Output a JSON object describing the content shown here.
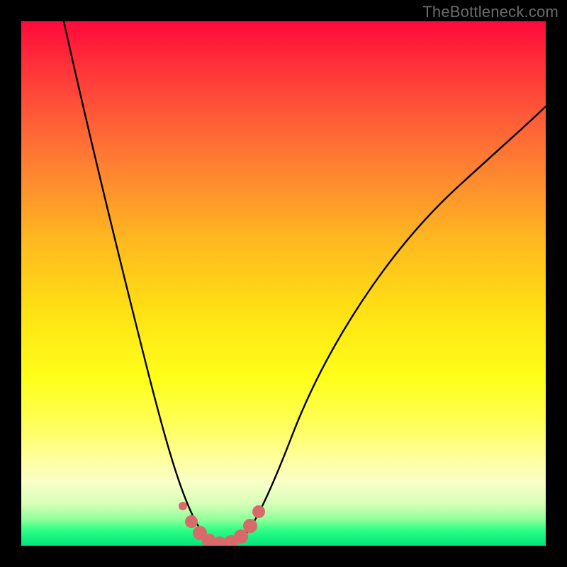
{
  "watermark": {
    "text": "TheBottleneck.com"
  },
  "colors": {
    "frame": "#000000",
    "curve": "#000000",
    "marker": "#d86a6a",
    "gradient_top": "#ff0a3a",
    "gradient_bottom": "#00e47a"
  },
  "chart_data": {
    "type": "line",
    "title": "",
    "xlabel": "",
    "ylabel": "",
    "xlim": [
      0,
      100
    ],
    "ylim": [
      0,
      100
    ],
    "grid": false,
    "legend": false,
    "annotations": [
      "TheBottleneck.com"
    ],
    "series": [
      {
        "name": "bottleneck-curve",
        "x": [
          8,
          10,
          12,
          15,
          18,
          21,
          24,
          27,
          29,
          31,
          33,
          35,
          37,
          39,
          42,
          46,
          50,
          55,
          60,
          66,
          72,
          78,
          85,
          92,
          100
        ],
        "y": [
          100,
          92,
          84,
          72,
          60,
          48,
          37,
          27,
          19,
          12,
          6,
          2,
          0,
          2,
          7,
          15,
          23,
          31,
          39,
          46,
          52,
          57,
          62,
          66,
          70
        ]
      },
      {
        "name": "optimal-zone-markers",
        "x": [
          31,
          33,
          35,
          37,
          39,
          41,
          43
        ],
        "y": [
          7,
          2,
          0,
          0,
          0,
          2,
          6
        ]
      }
    ],
    "minimum": {
      "x": 36,
      "y": 0
    }
  }
}
